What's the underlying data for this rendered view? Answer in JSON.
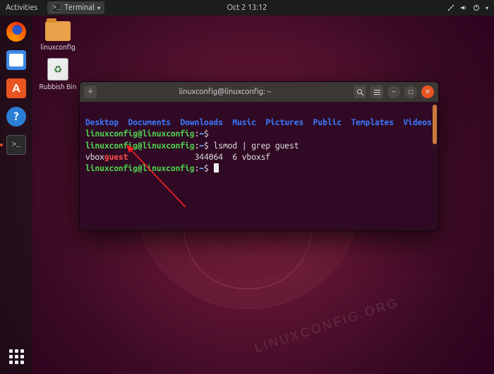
{
  "topbar": {
    "activities": "Activities",
    "app_menu": "Terminal",
    "clock": "Oct 2  13:12"
  },
  "status_icons": [
    "network-icon",
    "volume-icon",
    "power-icon"
  ],
  "dock": [
    {
      "name": "firefox-icon",
      "label": "Firefox"
    },
    {
      "name": "files-icon",
      "label": "Files"
    },
    {
      "name": "software-icon",
      "label": "Ubuntu Software"
    },
    {
      "name": "help-icon",
      "label": "Help"
    },
    {
      "name": "terminal-icon",
      "label": "Terminal",
      "running": true
    }
  ],
  "apps_button": "Show Applications",
  "desktop_icons": [
    {
      "name": "home-folder",
      "label": "linuxconfig"
    },
    {
      "name": "trash",
      "label": "Rubbish Bin"
    }
  ],
  "terminal": {
    "title": "linuxconfig@linuxconfig: ~",
    "toolbar": {
      "new_tab": "New Tab",
      "search": "Search",
      "menu": "Menu",
      "minimize": "Minimize",
      "maximize": "Maximize",
      "close": "Close"
    },
    "prompt_user": "linuxconfig@linuxconfig",
    "prompt_sep": ":",
    "prompt_path": "~",
    "prompt_end": "$",
    "ls_dirs": [
      "Desktop",
      "Documents",
      "Downloads",
      "Music",
      "Pictures",
      "Public",
      "Templates",
      "Videos"
    ],
    "cmd1": "",
    "cmd2": "lsmod | grep guest",
    "out_pre": "vbox",
    "out_hl": "guest",
    "out_rest": "              344064  6 vboxsf"
  },
  "watermark": "LINUXCONFIG.ORG"
}
